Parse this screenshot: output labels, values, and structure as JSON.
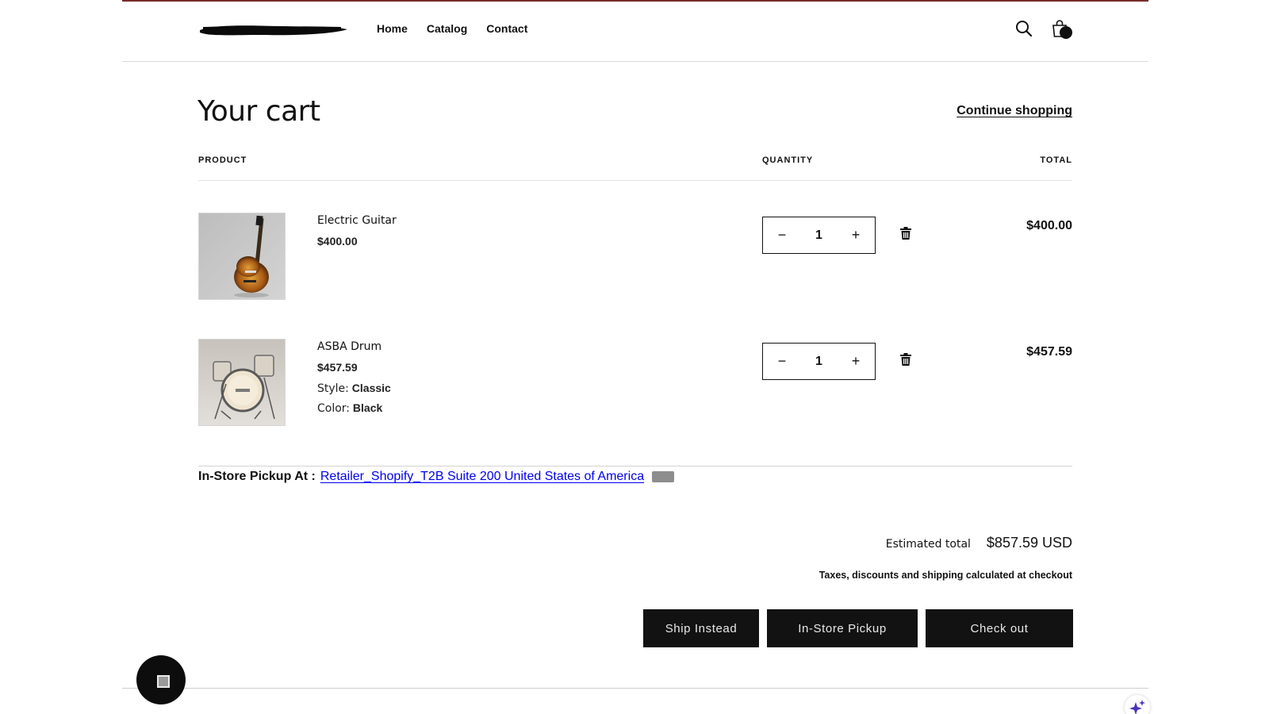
{
  "header": {
    "nav": [
      "Home",
      "Catalog",
      "Contact"
    ]
  },
  "cart": {
    "title": "Your cart",
    "continue_label": "Continue shopping",
    "columns": {
      "product": "PRODUCT",
      "quantity": "QUANTITY",
      "total": "TOTAL"
    },
    "items": [
      {
        "name": "Electric Guitar",
        "price": "$400.00",
        "quantity": "1",
        "line_total": "$400.00",
        "options": []
      },
      {
        "name": "ASBA Drum",
        "price": "$457.59",
        "quantity": "1",
        "line_total": "$457.59",
        "options": [
          {
            "key": "Style:",
            "value": "Classic"
          },
          {
            "key": "Color:",
            "value": "Black"
          }
        ]
      }
    ],
    "qty_minus": "−",
    "qty_plus": "+",
    "pickup_label": "In-Store Pickup At :",
    "pickup_address": "Retailer_Shopify_T2B Suite 200 United States of America",
    "estimated_label": "Estimated total",
    "estimated_value": "$857.59 USD",
    "tax_note": "Taxes, discounts and shipping calculated at checkout",
    "buttons": {
      "ship_instead": "Ship Instead",
      "in_store_pickup": "In-Store Pickup",
      "checkout": "Check out"
    }
  },
  "colors": {
    "accent_rule": "#7a2c2c",
    "button_bg": "#121212",
    "sparkle": "#5b3fd1"
  },
  "icons": [
    "logo-redacted",
    "search-icon",
    "cart-bag-icon",
    "trash-icon",
    "chat-icon",
    "sparkle-icon"
  ]
}
